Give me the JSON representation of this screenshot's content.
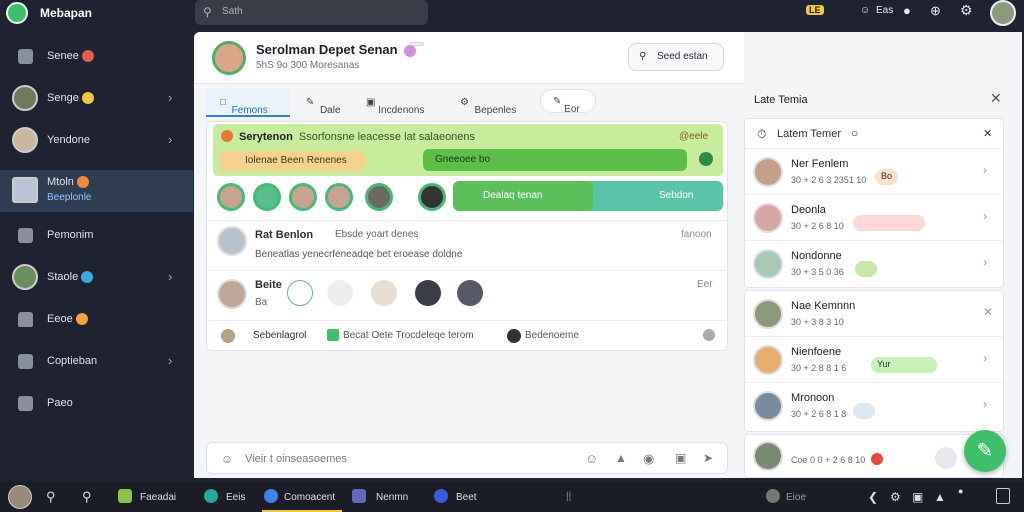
{
  "app": {
    "title": "Mebapan",
    "search_placeholder": "Sath"
  },
  "top_right": {
    "badge": "LE",
    "item": "Eas"
  },
  "sidebar": {
    "items": [
      {
        "label": "Senee",
        "icon": "folder-icon"
      },
      {
        "label": "Senge",
        "icon": "avatar"
      },
      {
        "label": "Yendone",
        "icon": "avatar"
      },
      {
        "label": "Mtoln",
        "sub": "Beeplonle",
        "icon": "avatar",
        "active": true
      },
      {
        "label": "Pemonim",
        "icon": "folder-icon"
      },
      {
        "label": "Staole",
        "icon": "avatar"
      },
      {
        "label": "Eeoe",
        "icon": "lock-icon"
      },
      {
        "label": "Coptieban",
        "icon": "puzzle-icon"
      },
      {
        "label": "Paeo",
        "icon": "flag-icon"
      }
    ]
  },
  "header": {
    "name": "Serolman Depet Senan",
    "pill": "",
    "sub": "5hS 9o 300 Moresanas",
    "search_label": "Seed estan",
    "reactions_label": "Nemreanes"
  },
  "tabs": [
    "Femons",
    "Dale",
    "Incdenons",
    "Bepenles",
    "Eor"
  ],
  "banner": {
    "title": "Serytenon",
    "text": "Ssorfonsne leacesse lat salaeonens",
    "right": "@eele",
    "button": "Iolenae Been Renenes",
    "bar": "Gneeoee bo"
  },
  "group_bar": {
    "left": "Dealaq tenan",
    "right": "Sebdon"
  },
  "messages": [
    {
      "name": "Rat Benlon",
      "meta": "Ebsde yoart denes",
      "time": "fanoon",
      "text": "Beneatlas yenecrfeneadqe bet eroease doldne"
    },
    {
      "name": "Beite",
      "sub": "Ba",
      "time": "Eer"
    },
    {
      "footer_a": "Sebenlagrol",
      "footer_b": "Becat Oete Trocdeleqe terom",
      "footer_c": "Bedenoeme"
    }
  ],
  "composer": {
    "placeholder": "Vieir t oinseasoemes"
  },
  "right_panel": {
    "title": "Late Temia",
    "sub_title": "Latem Temer",
    "items": [
      {
        "name": "Ner Fenlem",
        "meta": "30 + 2 6 3 2351 10",
        "pill": "Bo",
        "pill_color": "#fde0c8"
      },
      {
        "name": "Deonla",
        "meta": "30 + 2 6 8 10",
        "pill": "",
        "pill_color": "#fcd8d8"
      },
      {
        "name": "Nondonne",
        "meta": "30 + 3 5 0 36",
        "pill": "",
        "pill_color": "#e6f7d6"
      },
      {
        "name": "Nae Kemnnn",
        "meta": "30 + 3 8 3 10",
        "pill": "",
        "pill_color": "#ffffff"
      },
      {
        "name": "Nienfoene",
        "meta": "30 + 2 8 8 1 6",
        "pill": "Yur",
        "pill_color": "#c9f0b8"
      },
      {
        "name": "Mronoon",
        "meta": "30 + 2 6 8 1 8",
        "pill": "",
        "pill_color": "#ffffff"
      },
      {
        "name": "",
        "meta": "Coe 0 0 + 2 6 8 10",
        "pill": "",
        "pill_color": "#ffffff"
      }
    ]
  },
  "taskbar": [
    {
      "label": "Faeadai",
      "color": "#8bc34a"
    },
    {
      "label": "Eeis",
      "color": "#26a69a"
    },
    {
      "label": "Comoacent",
      "color": "#3b82f6"
    },
    {
      "label": "Nenmn",
      "color": "#5c6bc0"
    },
    {
      "label": "Beet",
      "color": "#3b5bdb"
    },
    {
      "label": "Eioe",
      "color": "#777"
    }
  ],
  "colors": {
    "accent": "#3fbf6a",
    "bg_dark": "#1f2230",
    "active": "#2f3d52"
  }
}
